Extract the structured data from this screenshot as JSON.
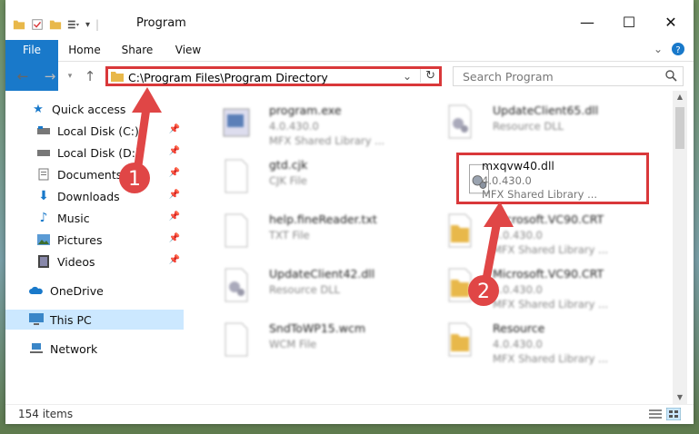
{
  "window": {
    "title": "Program",
    "min_symbol": "—",
    "max_symbol": "☐",
    "close_symbol": "✕"
  },
  "ribbon": {
    "tabs": [
      "File",
      "Home",
      "Share",
      "View"
    ],
    "expand_icon": "chevron-down-icon",
    "help_icon": "help-icon"
  },
  "address": {
    "path": "C:\\Program Files\\Program Directory",
    "search_placeholder": "Search Program"
  },
  "sidebar": {
    "items": [
      {
        "label": "Quick access",
        "icon": "star-icon",
        "pinned": false
      },
      {
        "label": "Local Disk (C:)",
        "icon": "drive-icon",
        "pinned": true
      },
      {
        "label": "Local Disk (D:)",
        "icon": "drive-icon",
        "pinned": true
      },
      {
        "label": "Documents",
        "icon": "documents-icon",
        "pinned": true
      },
      {
        "label": "Downloads",
        "icon": "downloads-icon",
        "pinned": true
      },
      {
        "label": "Music",
        "icon": "music-icon",
        "pinned": true
      },
      {
        "label": "Pictures",
        "icon": "pictures-icon",
        "pinned": true
      },
      {
        "label": "Videos",
        "icon": "videos-icon",
        "pinned": true
      },
      {
        "label": "OneDrive",
        "icon": "cloud-icon",
        "pinned": false
      },
      {
        "label": "This PC",
        "icon": "computer-icon",
        "pinned": false,
        "selected": true
      },
      {
        "label": "Network",
        "icon": "network-icon",
        "pinned": false
      }
    ]
  },
  "files": {
    "left": [
      {
        "name": "program.exe",
        "line1": "4.0.430.0",
        "line2": "MFX Shared Library ...",
        "icon": "exe-icon"
      },
      {
        "name": "gtd.cjk",
        "line1": "CJK File",
        "line2": "",
        "icon": "blank-file-icon"
      },
      {
        "name": "help.fineReader.txt",
        "line1": "TXT File",
        "line2": "",
        "icon": "blank-file-icon"
      },
      {
        "name": "UpdateClient42.dll",
        "line1": "Resource DLL",
        "line2": "",
        "icon": "dll-icon"
      },
      {
        "name": "SndToWP15.wcm",
        "line1": "WCM File",
        "line2": "",
        "icon": "blank-file-icon"
      }
    ],
    "right": [
      {
        "name": "UpdateClient65.dll",
        "line1": "Resource DLL",
        "line2": "",
        "icon": "dll-icon"
      },
      {
        "name": "mxqvw40.dll",
        "line1": "4.0.430.0",
        "line2": "MFX Shared Library ...",
        "icon": "dll-icon",
        "highlighted": true
      },
      {
        "name": "Microsoft.VC90.CRT",
        "line1": "4.0.430.0",
        "line2": "MFX Shared Library ...",
        "icon": "folder-file-icon"
      },
      {
        "name": "Microsoft.VC90.CRT",
        "line1": "4.0.430.0",
        "line2": "MFX Shared Library ...",
        "icon": "folder-file-icon"
      },
      {
        "name": "Resource",
        "line1": "4.0.430.0",
        "line2": "MFX Shared Library ...",
        "icon": "folder-file-icon"
      }
    ]
  },
  "annotations": {
    "step1": "1",
    "step2": "2",
    "accent": "#d9383a"
  },
  "status": {
    "count": "154 items"
  },
  "colors": {
    "file_tab": "#1979ca",
    "selected_nav": "#cce8ff",
    "folder": "#e8b84a"
  }
}
